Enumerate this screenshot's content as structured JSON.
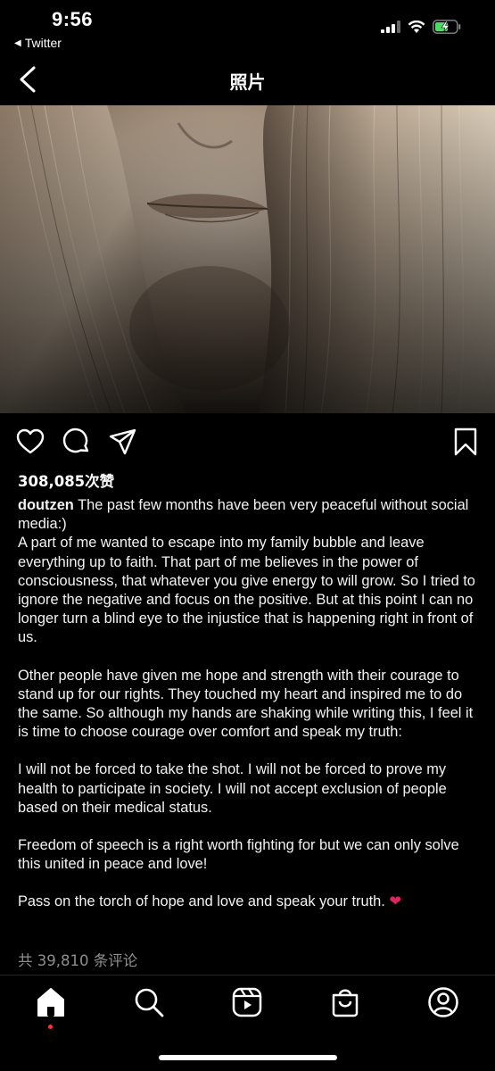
{
  "status_bar": {
    "time": "9:56",
    "back_app": "Twitter"
  },
  "header": {
    "title": "照片"
  },
  "post": {
    "likes": "308,085次赞",
    "username": "doutzen",
    "caption_first": " The past few months have been very peaceful without social media:)",
    "paragraph_1": "A part of me wanted to escape into my family bubble and leave everything up to faith. That part of me believes in the power of consciousness, that whatever you give energy to will grow. So I tried to ignore the negative and focus on the positive. But at this point I can no longer turn a blind eye to the injustice that is happening right in front of us.",
    "paragraph_2": "Other people have given me hope and strength with their courage to stand up for our rights. They touched my heart and inspired me to do the same. So although my hands are shaking while writing this, I feel it is time to choose courage over comfort and speak my truth:",
    "paragraph_3": "I will not be forced to take the shot. I will not be forced to prove my health to participate in society. I will not accept exclusion of people based on their medical status.",
    "paragraph_4": "Freedom of speech is a right worth fighting for but we can only solve this united in peace and love!",
    "paragraph_5": "Pass on the torch of hope and love and speak your truth. ",
    "heart_emoji": "❤",
    "comments": "共 39,810 条评论"
  },
  "icons": {
    "like": "heart-outline-icon",
    "comment": "comment-bubble-icon",
    "share": "paper-plane-icon",
    "save": "bookmark-icon",
    "tabs": [
      "home-icon",
      "search-icon",
      "reels-icon",
      "shop-bag-icon",
      "profile-icon"
    ]
  },
  "colors": {
    "background": "#000000",
    "secondary_text": "#8e8e8e",
    "notification_dot": "#ff3040",
    "battery_green": "#4cd964"
  }
}
